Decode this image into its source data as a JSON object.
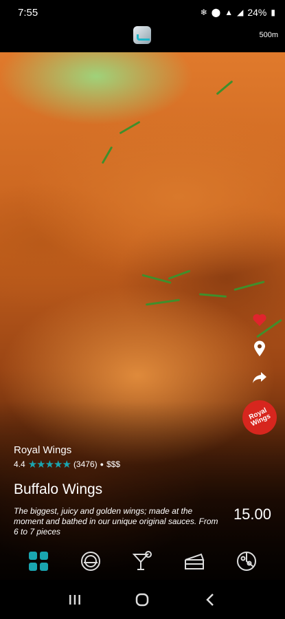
{
  "status": {
    "time": "7:55",
    "battery": "24%"
  },
  "header": {
    "distance": "500m"
  },
  "restaurant": {
    "name": "Royal Wings",
    "rating": "4.4",
    "rating_stars": 4.4,
    "review_count": "(3476)",
    "separator": "●",
    "price_level": "$$$",
    "badge_text": "Royal Wings"
  },
  "dish": {
    "name": "Buffalo Wings",
    "description": "The biggest, juicy and golden wings; made at the moment and bathed in our unique original sauces. From 6 to 7 pieces",
    "price": "15.00"
  },
  "colors": {
    "accent": "#1aa5b0",
    "favorite": "#e0242d",
    "brand_badge": "#d7261e"
  },
  "icons": {
    "side": [
      "heart-icon",
      "location-pin-icon",
      "share-icon"
    ],
    "tabs": [
      "grid-icon",
      "plate-icon",
      "cocktail-icon",
      "cake-icon",
      "pizza-icon"
    ],
    "nav": [
      "recents-icon",
      "home-icon",
      "back-icon"
    ]
  }
}
